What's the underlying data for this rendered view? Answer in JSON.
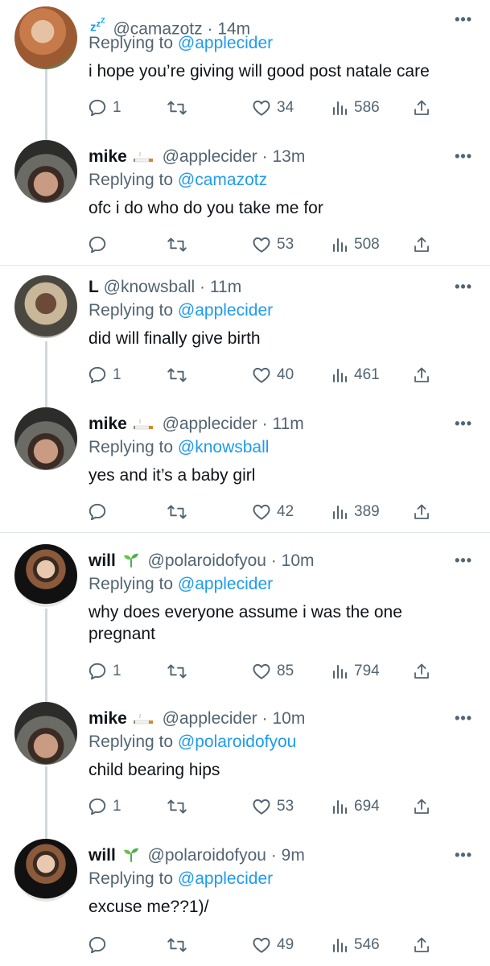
{
  "tweets": [
    {
      "name": "",
      "handle": "@camazotz",
      "time": "14m",
      "reply_prefix": "Replying to ",
      "reply_to": "@applecider",
      "text": "i hope you’re giving will good post natale care",
      "replies": "1",
      "likes": "34",
      "views": "586",
      "avatar": "camazotz",
      "badge_icon": "sleeping-zzz-icon"
    },
    {
      "name": "mike",
      "handle": "@applecider",
      "time": "13m",
      "reply_prefix": "Replying to ",
      "reply_to": "@camazotz",
      "text": "ofc i do who do you take me for",
      "replies": "",
      "likes": "53",
      "views": "508",
      "avatar": "mike",
      "badge_icon": "cigarette-icon"
    },
    {
      "name": "L",
      "handle": "@knowsball",
      "time": "11m",
      "reply_prefix": "Replying to ",
      "reply_to": "@applecider",
      "text": "did will finally give birth",
      "replies": "1",
      "likes": "40",
      "views": "461",
      "avatar": "l",
      "badge_icon": ""
    },
    {
      "name": "mike",
      "handle": "@applecider",
      "time": "11m",
      "reply_prefix": "Replying to ",
      "reply_to": "@knowsball",
      "text": "yes and it’s a baby girl",
      "replies": "",
      "likes": "42",
      "views": "389",
      "avatar": "mike",
      "badge_icon": "cigarette-icon"
    },
    {
      "name": "will",
      "handle": "@polaroidofyou",
      "time": "10m",
      "reply_prefix": "Replying to ",
      "reply_to": "@applecider",
      "text": "why does everyone assume i was the one pregnant",
      "replies": "1",
      "likes": "85",
      "views": "794",
      "avatar": "will",
      "badge_icon": "seedling-icon"
    },
    {
      "name": "mike",
      "handle": "@applecider",
      "time": "10m",
      "reply_prefix": "Replying to ",
      "reply_to": "@polaroidofyou",
      "text": "child bearing hips",
      "replies": "1",
      "likes": "53",
      "views": "694",
      "avatar": "mike",
      "badge_icon": "cigarette-icon"
    },
    {
      "name": "will",
      "handle": "@polaroidofyou",
      "time": "9m",
      "reply_prefix": "Replying to ",
      "reply_to": "@applecider",
      "text": "excuse me??1)/",
      "replies": "",
      "likes": "49",
      "views": "546",
      "avatar": "will",
      "badge_icon": "seedling-icon"
    }
  ],
  "colors": {
    "accent": "#1d9bf0",
    "secondary_text": "#536471",
    "text": "#0f1419",
    "thread_line": "#cfd9de"
  }
}
